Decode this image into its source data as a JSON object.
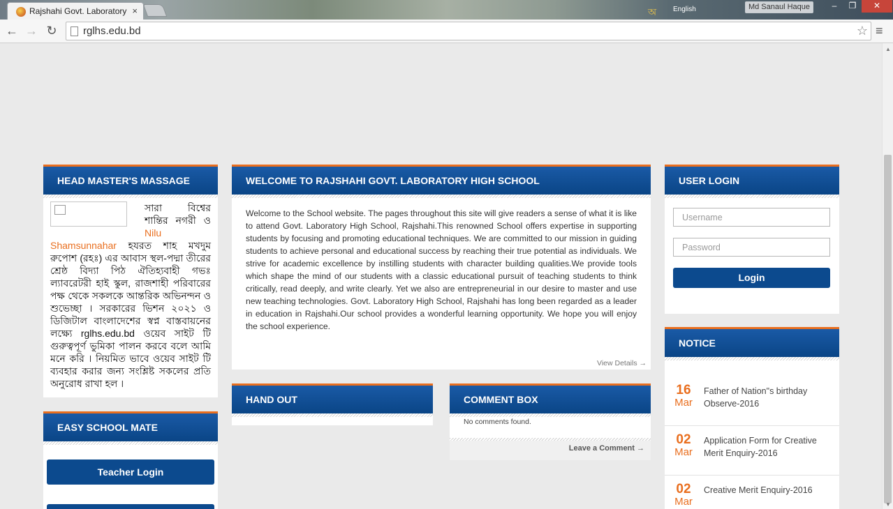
{
  "browser": {
    "tab_title": "Rajshahi Govt. Laboratory",
    "tab_close": "×",
    "language_icon": "অ",
    "language_label": "English",
    "profile_name": "Md Sanaul Haque",
    "url": "rglhs.edu.bd",
    "icons": {
      "back": "←",
      "forward": "→",
      "reload": "↻",
      "star": "☆",
      "menu": "≡",
      "minimize": "–",
      "maximize": "❐",
      "close": "✕",
      "scroll_up": "▲",
      "scroll_down": "▼"
    }
  },
  "headmaster": {
    "heading": "HEAD MASTER'S MASSAGE",
    "intro": "সারা বিশ্বের শান্তির নগরী ও",
    "name": "Nilu Shamsunnahar",
    "message": " হযরত শাহ মখদুম রুপোশ (রহঃ) এর আবাস স্থল-পদ্মা তীরের শ্রেষ্ঠ বিদ্যা পিঠ ঐতিহ্যবাহী গভঃ ল্যাবরেটরী হাই স্কুল, রাজশাহী পরিবারের পক্ষ থেকে সকলকে আন্তরিক অভিনন্দন ও শুভেচ্ছা । সরকারের ভিশন ২০২১ ও ডিজিটাল বাংলাদেশের স্বপ্ন বাস্তবায়নের লক্ষ্যে rglhs.edu.bd ওয়েব সাইট টি গুরুত্বপূর্ণ ভুমিকা পালন করবে বলে আমি মনে করি । নিয়মিত ভাবে ওয়েব সাইট টি ব্যবহার করার জন্য সংশ্লিষ্ট সকলের প্রতি অনুরোধ রাখা হল ।"
  },
  "easy_school_mate": {
    "heading": "EASY SCHOOL MATE",
    "teacher_login": "Teacher Login"
  },
  "welcome": {
    "heading": "WELCOME TO RAJSHAHI GOVT. LABORATORY HIGH SCHOOL",
    "text": "Welcome to the School website. The pages throughout this site will give readers a sense of what it is like to attend Govt. Laboratory High School, Rajshahi.This renowned School offers expertise in supporting students by focusing and promoting educational techniques. We are committed to our mission in guiding students to achieve personal and educational success by reaching their true potential as individuals. We strive for academic excellence by instilling students with character building qualities.We provide tools which shape the mind of our students with a classic educational pursuit of teaching students to think critically, read deeply, and write clearly. Yet we also are entrepreneurial in our desire to master and use new teaching technologies. Govt. Laboratory High School, Rajshahi has long been regarded as a leader in education in Rajshahi.Our school provides a wonderful learning opportunity. We hope you will enjoy the school experience.",
    "view_details": "View Details →"
  },
  "handout": {
    "heading": "HAND OUT"
  },
  "comment_box": {
    "heading": "COMMENT BOX",
    "empty_text": "No comments found.",
    "leave_comment": "Leave a Comment →"
  },
  "login": {
    "heading": "USER LOGIN",
    "username_placeholder": "Username",
    "password_placeholder": "Password",
    "button": "Login"
  },
  "notice": {
    "heading": "NOTICE",
    "items": [
      {
        "day": "16",
        "month": "Mar",
        "title": "Father of Nation\"s birthday Observe-2016"
      },
      {
        "day": "02",
        "month": "Mar",
        "title": "Application Form for Creative Merit Enquiry-2016"
      },
      {
        "day": "02",
        "month": "Mar",
        "title": "Creative Merit Enquiry-2016"
      }
    ]
  },
  "colors": {
    "header_blue": "#0a4586",
    "accent_orange": "#e96e1e",
    "page_background": "#eaeaea"
  }
}
